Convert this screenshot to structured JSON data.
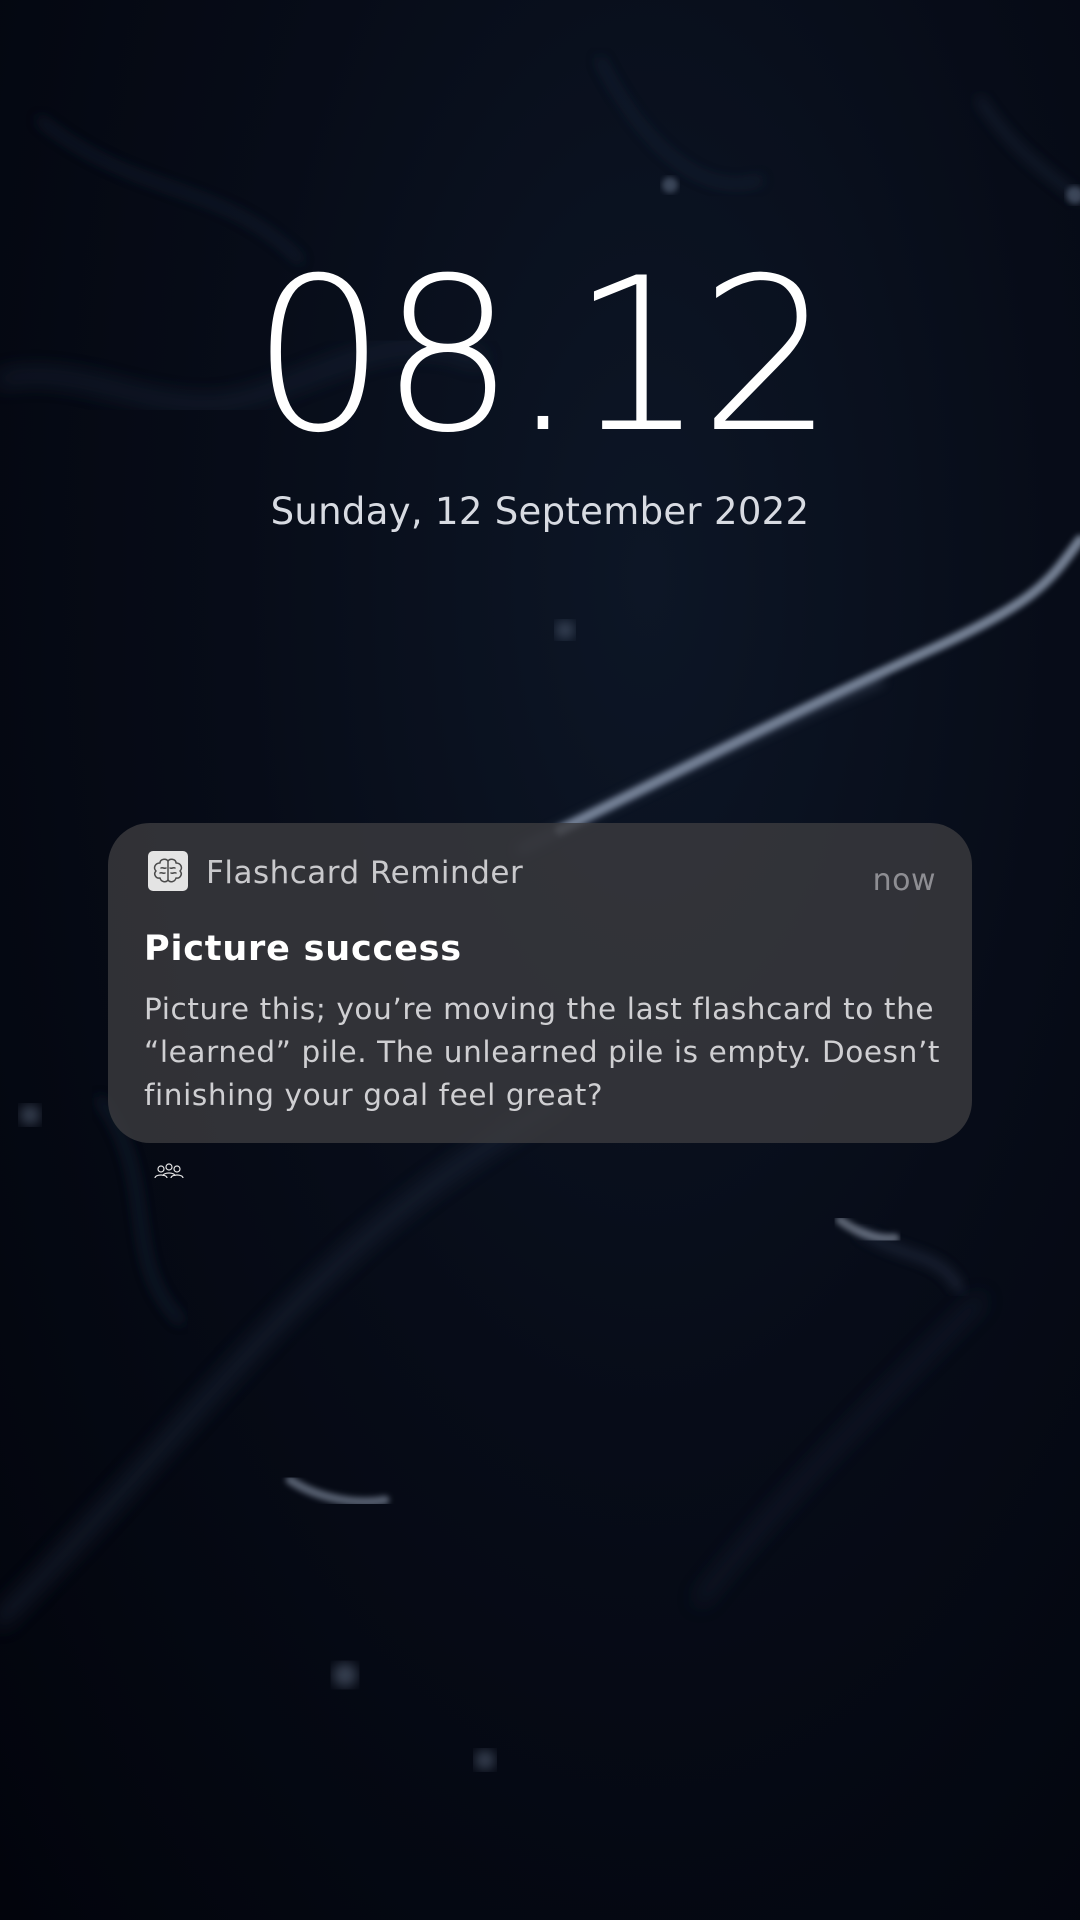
{
  "lockscreen": {
    "time": "08.12",
    "date": "Sunday, 12 September 2022"
  },
  "notification": {
    "app_icon": "brain-icon",
    "app_name": "Flashcard Reminder",
    "timestamp": "now",
    "title": "Picture success",
    "body": "Picture this; you’re moving the last flashcard to the “learned” pile. The unlearned pile is empty. Doesn’t finishing your goal feel great?"
  },
  "below_notification_icon": "people-group-icon",
  "colors": {
    "background": "#050a16",
    "notification_bg": "#3a3a3e",
    "clock_text": "#ffffff"
  }
}
